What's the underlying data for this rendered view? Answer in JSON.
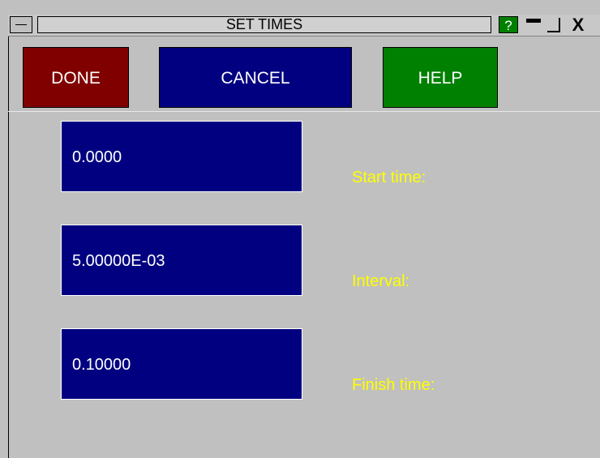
{
  "window": {
    "title": "SET TIMES",
    "help_glyph": "?",
    "close_glyph": "X"
  },
  "toolbar": {
    "done_label": "DONE",
    "cancel_label": "CANCEL",
    "help_label": "HELP"
  },
  "fields": [
    {
      "value": "0.0000",
      "label": "Start time:"
    },
    {
      "value": "5.00000E-03",
      "label": "Interval:"
    },
    {
      "value": "0.10000",
      "label": "Finish time:"
    }
  ],
  "colors": {
    "background": "#c0c0c0",
    "done": "#800000",
    "cancel": "#000080",
    "help": "#008000",
    "field": "#000080",
    "label": "#ffff00"
  },
  "icons": {
    "system_menu": "dash-menu-icon",
    "minimize": "minimize-icon",
    "maximize": "maximize-icon",
    "close": "close-icon",
    "help": "help-icon"
  }
}
